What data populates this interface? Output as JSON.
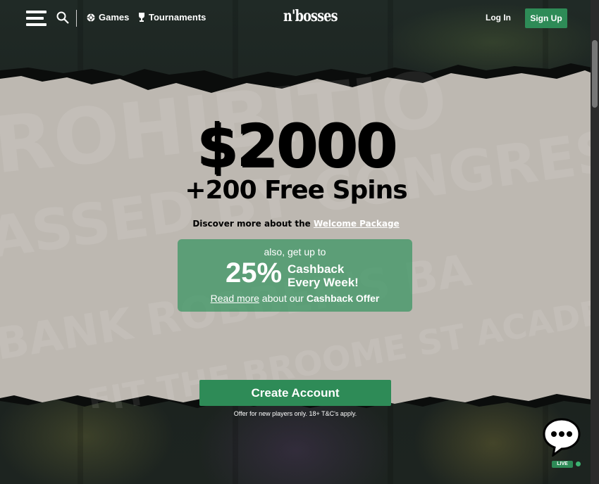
{
  "header": {
    "games_label": "Games",
    "tournaments_label": "Tournaments",
    "logo_text": "n'bosses",
    "login_label": "Log In",
    "signup_label": "Sign Up"
  },
  "hero": {
    "amount": "$2000",
    "free_spins": "+200 Free Spins",
    "discover_text": "Discover more about the",
    "welcome_link": "Welcome Package"
  },
  "cashback": {
    "top_text": "also, get up to",
    "percent": "25%",
    "line1": "Cashback",
    "line2": "Every Week!",
    "read_more": "Read more",
    "about_text": "about our",
    "offer_name": "Cashback Offer"
  },
  "cta": {
    "create_account": "Create Account",
    "disclaimer": "Offer for new players only. 18+ T&C's apply."
  },
  "chat": {
    "live_label": "LIVE"
  },
  "colors": {
    "accent": "#2e8b57",
    "paper": "#bdb8b1",
    "background": "#1b201d"
  }
}
